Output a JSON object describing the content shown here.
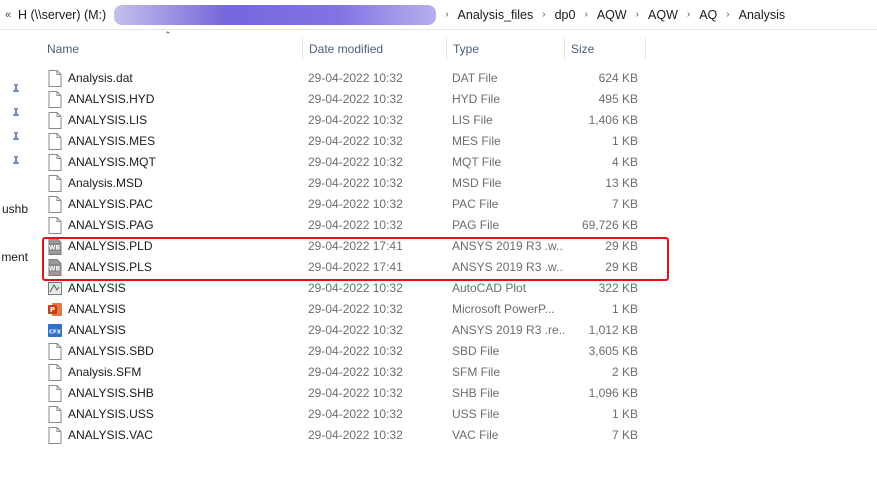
{
  "breadcrumb": {
    "back": "«",
    "sep": "›",
    "drive": "H (\\\\server) (M:)",
    "items": [
      "Analysis_files",
      "dp0",
      "AQW",
      "AQW",
      "AQ",
      "Analysis"
    ]
  },
  "nav": {
    "partial_items": [
      "ushb",
      "ment"
    ]
  },
  "columns": {
    "name": "Name",
    "date": "Date modified",
    "type": "Type",
    "size": "Size"
  },
  "files": [
    {
      "name": "Analysis.dat",
      "date": "29-04-2022 10:32",
      "type": "DAT File",
      "size": "624 KB",
      "icon": "generic-file-icon"
    },
    {
      "name": "ANALYSIS.HYD",
      "date": "29-04-2022 10:32",
      "type": "HYD File",
      "size": "495 KB",
      "icon": "generic-file-icon"
    },
    {
      "name": "ANALYSIS.LIS",
      "date": "29-04-2022 10:32",
      "type": "LIS File",
      "size": "1,406 KB",
      "icon": "generic-file-icon"
    },
    {
      "name": "ANALYSIS.MES",
      "date": "29-04-2022 10:32",
      "type": "MES File",
      "size": "1 KB",
      "icon": "generic-file-icon"
    },
    {
      "name": "ANALYSIS.MQT",
      "date": "29-04-2022 10:32",
      "type": "MQT File",
      "size": "4 KB",
      "icon": "generic-file-icon"
    },
    {
      "name": "Analysis.MSD",
      "date": "29-04-2022 10:32",
      "type": "MSD File",
      "size": "13 KB",
      "icon": "generic-file-icon"
    },
    {
      "name": "ANALYSIS.PAC",
      "date": "29-04-2022 10:32",
      "type": "PAC File",
      "size": "7 KB",
      "icon": "generic-file-icon"
    },
    {
      "name": "ANALYSIS.PAG",
      "date": "29-04-2022 10:32",
      "type": "PAG File",
      "size": "69,726 KB",
      "icon": "generic-file-icon"
    },
    {
      "name": "ANALYSIS.PLD",
      "date": "29-04-2022 17:41",
      "type": "ANSYS 2019 R3 .w...",
      "size": "29 KB",
      "icon": "ansys-wb-icon"
    },
    {
      "name": "ANALYSIS.PLS",
      "date": "29-04-2022 17:41",
      "type": "ANSYS 2019 R3 .w...",
      "size": "29 KB",
      "icon": "ansys-wb-icon"
    },
    {
      "name": "ANALYSIS",
      "date": "29-04-2022 10:32",
      "type": "AutoCAD Plot",
      "size": "322 KB",
      "icon": "autocad-plot-icon"
    },
    {
      "name": "ANALYSIS",
      "date": "29-04-2022 10:32",
      "type": "Microsoft PowerP...",
      "size": "1 KB",
      "icon": "powerpoint-icon"
    },
    {
      "name": "ANALYSIS",
      "date": "29-04-2022 10:32",
      "type": "ANSYS 2019 R3 .re...",
      "size": "1,012 KB",
      "icon": "ansys-cfx-icon"
    },
    {
      "name": "ANALYSIS.SBD",
      "date": "29-04-2022 10:32",
      "type": "SBD File",
      "size": "3,605 KB",
      "icon": "generic-file-icon"
    },
    {
      "name": "Analysis.SFM",
      "date": "29-04-2022 10:32",
      "type": "SFM File",
      "size": "2 KB",
      "icon": "generic-file-icon"
    },
    {
      "name": "ANALYSIS.SHB",
      "date": "29-04-2022 10:32",
      "type": "SHB File",
      "size": "1,096 KB",
      "icon": "generic-file-icon"
    },
    {
      "name": "ANALYSIS.USS",
      "date": "29-04-2022 10:32",
      "type": "USS File",
      "size": "1 KB",
      "icon": "generic-file-icon"
    },
    {
      "name": "ANALYSIS.VAC",
      "date": "29-04-2022 10:32",
      "type": "VAC File",
      "size": "7 KB",
      "icon": "generic-file-icon"
    }
  ],
  "icon_labels": {
    "wb": "WB",
    "cfx": "CFX",
    "ppt": "P"
  },
  "colors": {
    "highlight": "#e0121a",
    "header_text": "#4c607a",
    "redaction": "#5b4cd6"
  }
}
